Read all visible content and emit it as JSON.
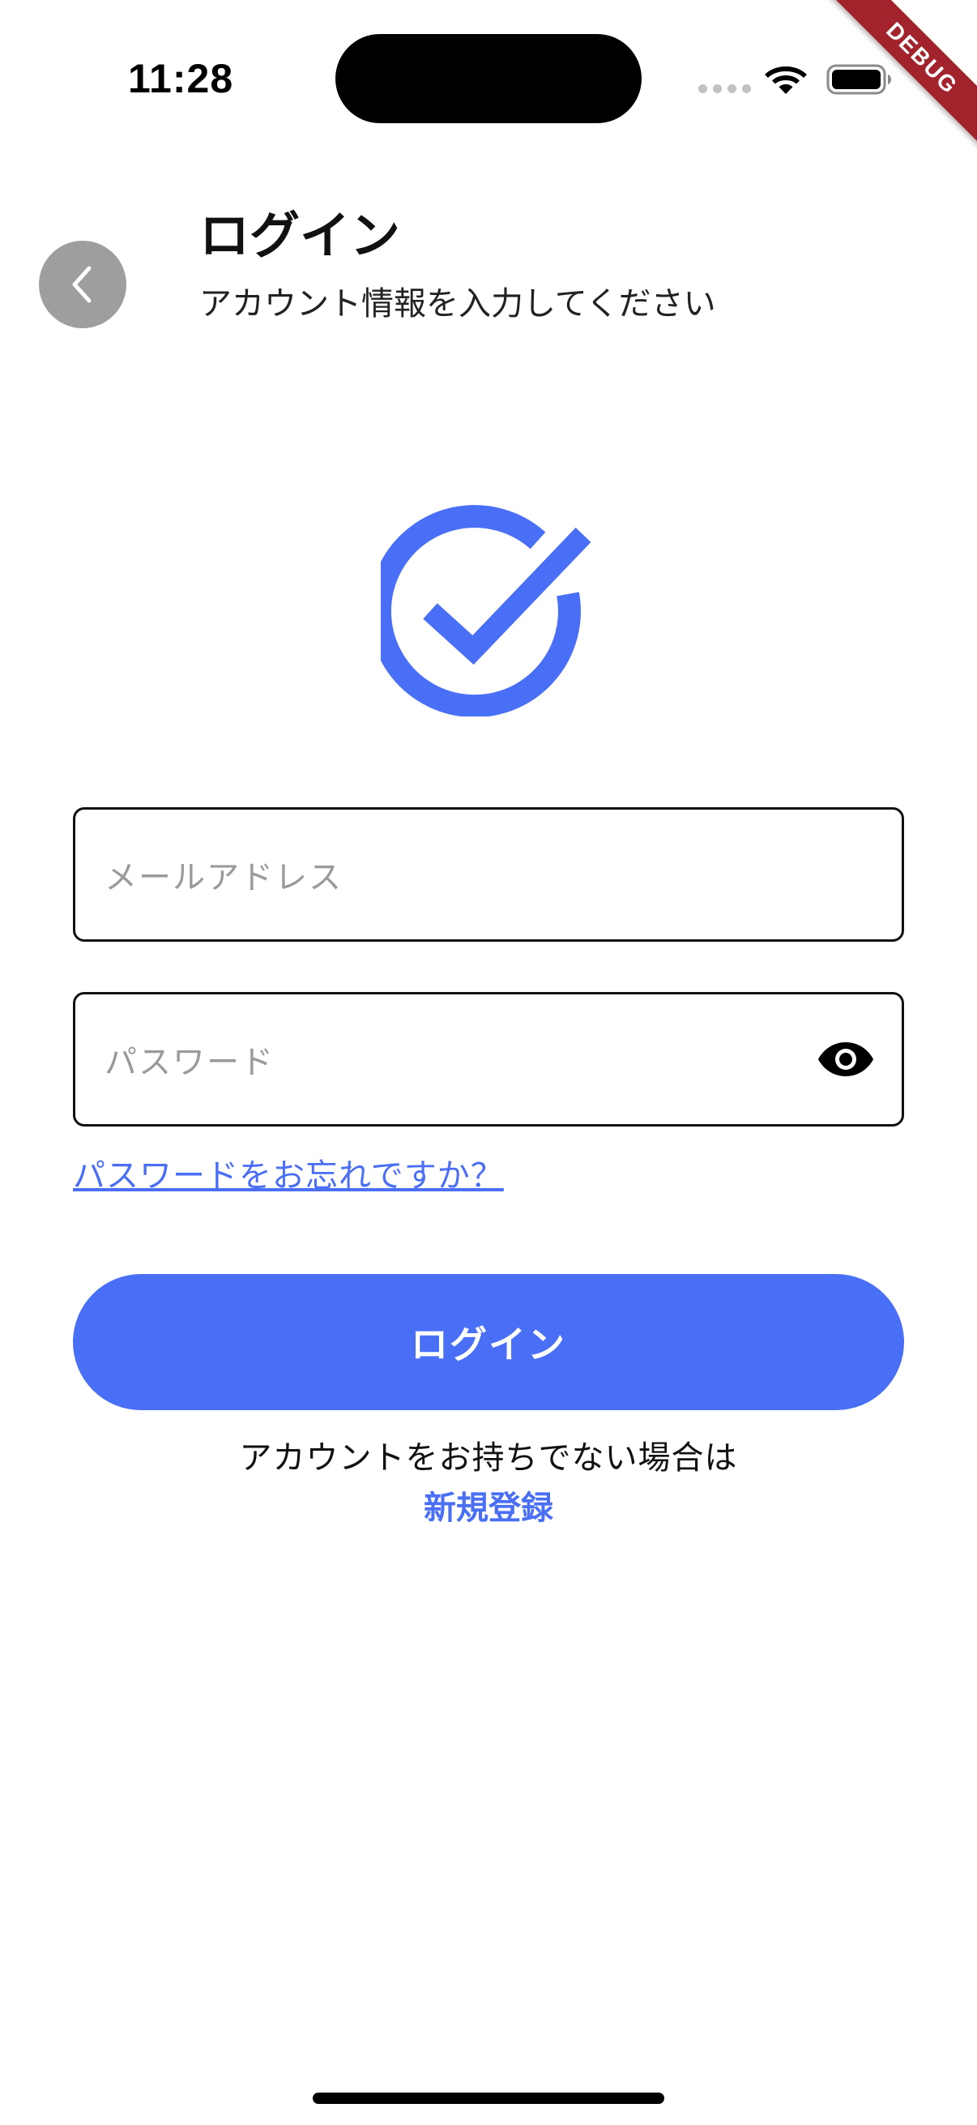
{
  "status_bar": {
    "time": "11:28"
  },
  "debug_banner": "DEBUG",
  "header": {
    "title": "ログイン",
    "subtitle": "アカウント情報を入力してください"
  },
  "form": {
    "email_placeholder": "メールアドレス",
    "password_placeholder": "パスワード",
    "forgot_password": "パスワードをお忘れですか？",
    "login_button": "ログイン"
  },
  "footer": {
    "no_account_text": "アカウントをお持ちでない場合は",
    "signup_link": "新規登録"
  },
  "icons": {
    "back": "chevron-left-icon",
    "logo": "check-circle-icon",
    "password_toggle": "eye-icon",
    "wifi": "wifi-icon",
    "battery": "battery-icon"
  },
  "colors": {
    "accent": "#4a6ff7",
    "link": "#4a6ff5",
    "back_button": "#9e9e9e",
    "debug_ribbon": "#a3232c"
  }
}
